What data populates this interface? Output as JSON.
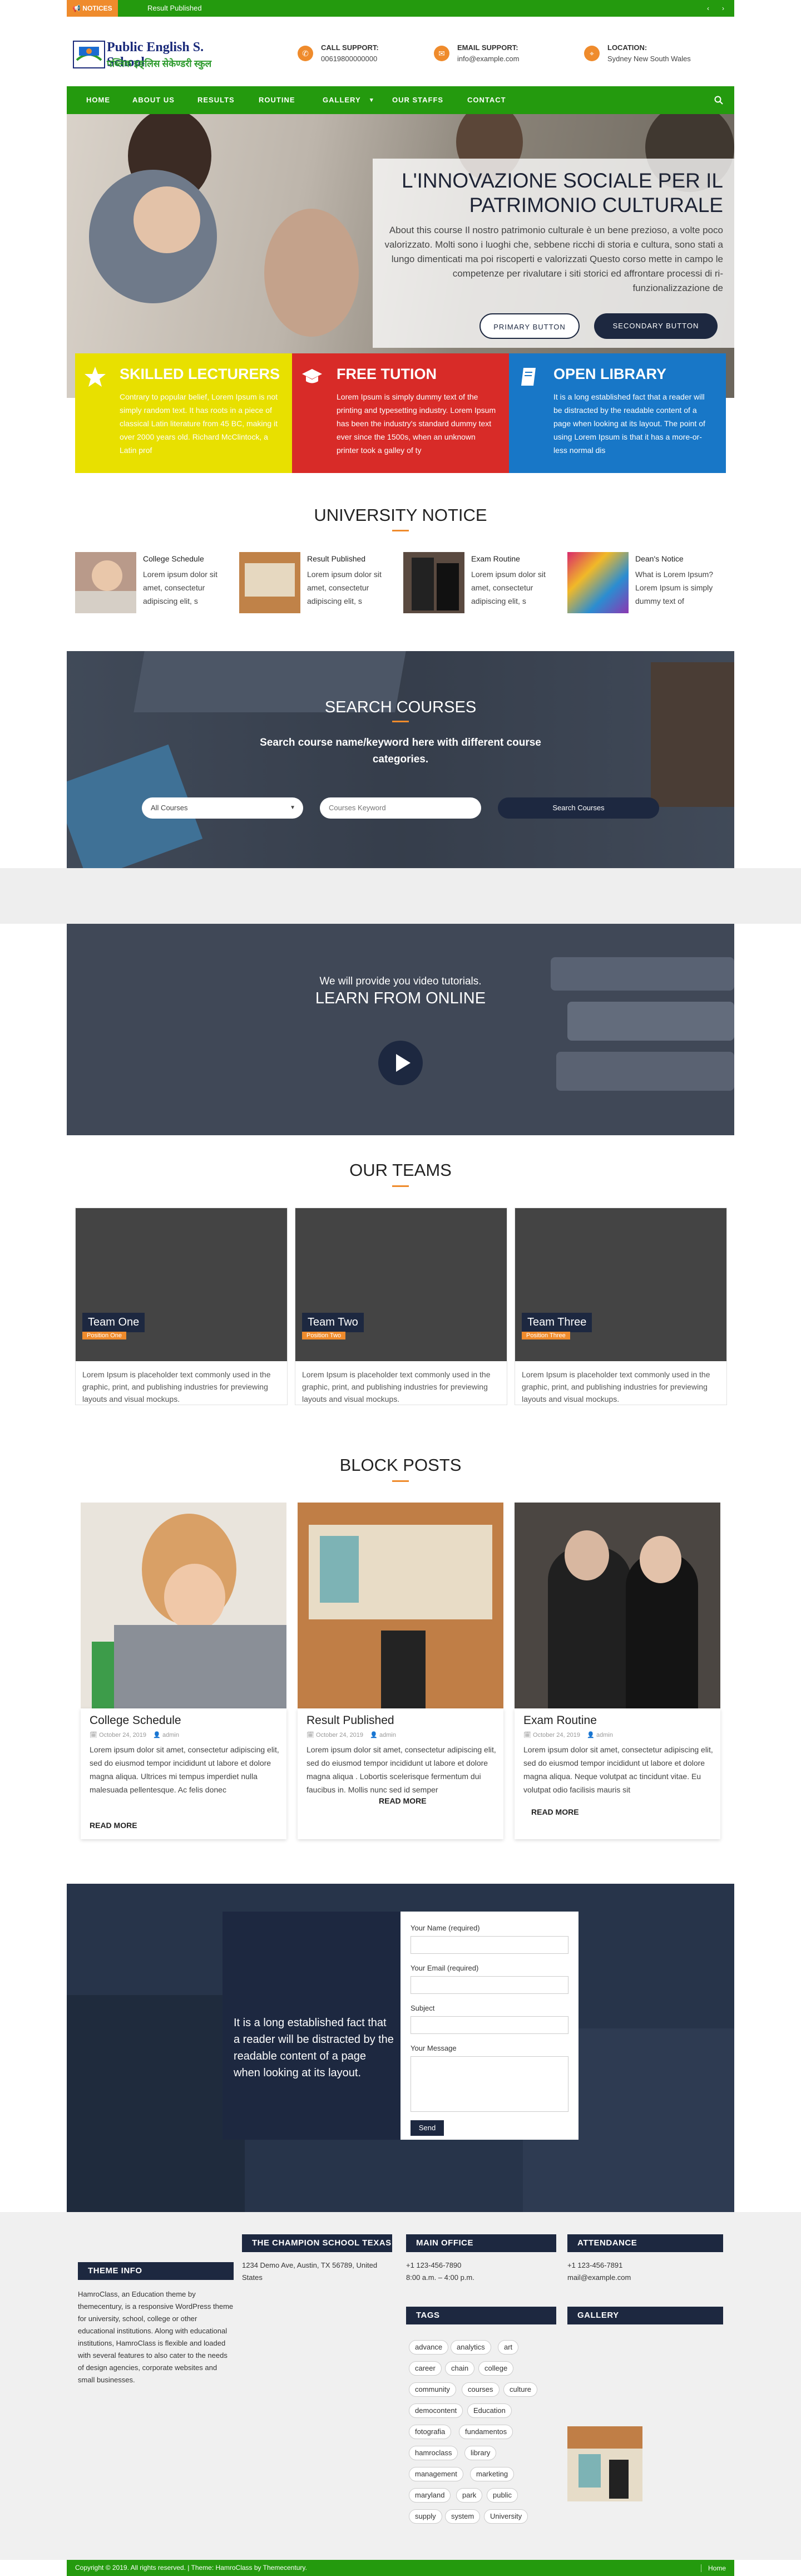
{
  "topbar": {
    "notice_label": "NOTICES",
    "notice_text": "Result Published",
    "prev": "‹",
    "next": "›"
  },
  "header": {
    "logo_title": "Public English S. School",
    "logo_subtitle": "पब्लिक इङ्लिस सेकेण्डरी स्कुल",
    "call": {
      "label": "CALL SUPPORT:",
      "value": "00619800000000"
    },
    "email": {
      "label": "EMAIL SUPPORT:",
      "value": "info@example.com"
    },
    "location": {
      "label": "LOCATION:",
      "value": "Sydney New South Wales"
    }
  },
  "nav": {
    "items": [
      "HOME",
      "ABOUT US",
      "RESULTS",
      "ROUTINE",
      "GALLERY",
      "OUR STAFFS",
      "CONTACT"
    ],
    "gallery_caret": "▾"
  },
  "hero": {
    "title": "L'INNOVAZIONE SOCIALE PER IL PATRIMONIO CULTURALE",
    "text": "About this course Il nostro patrimonio culturale è un bene prezioso, a volte poco valorizzato. Molti sono i luoghi che, sebbene ricchi di storia e cultura, sono stati a lungo dimenticati ma poi riscoperti e valorizzati Questo corso mette in campo le competenze per rivalutare i siti storici ed affrontare processi di ri-funzionalizzazione de",
    "primary": "PRIMARY BUTTON",
    "secondary": "SECONDARY BUTTON"
  },
  "features": [
    {
      "title": "SKILLED LECTURERS",
      "text": "Contrary to popular belief, Lorem Ipsum is not simply random text. It has roots in a piece of classical Latin literature from 45 BC, making it over 2000 years old. Richard McClintock, a Latin prof",
      "color": "#e8e000"
    },
    {
      "title": "FREE TUTION",
      "text": "Lorem Ipsum is simply dummy text of the printing and typesetting industry. Lorem Ipsum has been the industry's standard dummy text ever since the 1500s, when an unknown printer took a galley of ty",
      "color": "#d82b28"
    },
    {
      "title": "OPEN LIBRARY",
      "text": "It is a long established fact that a reader will be distracted by the readable content of a page when looking at its layout. The point of using Lorem Ipsum is that it has a more-or-less normal dis",
      "color": "#1877c7"
    }
  ],
  "notice": {
    "title": "UNIVERSITY NOTICE",
    "items": [
      {
        "title": "College Schedule",
        "text": "Lorem ipsum dolor sit amet, consectetur adipiscing elit, s"
      },
      {
        "title": "Result Published",
        "text": "Lorem ipsum dolor sit amet, consectetur adipiscing elit, s"
      },
      {
        "title": "Exam Routine",
        "text": "Lorem ipsum dolor sit amet, consectetur adipiscing elit, s"
      },
      {
        "title": "Dean's Notice",
        "text": "What is Lorem Ipsum? Lorem Ipsum is simply dummy text of"
      }
    ]
  },
  "search": {
    "title": "SEARCH COURSES",
    "subtitle": "Search course name/keyword here with different course categories.",
    "select": "All Courses",
    "placeholder": "Courses Keyword",
    "button": "Search Courses"
  },
  "video": {
    "subtitle": "We will provide you video tutorials.",
    "title": "LEARN FROM ONLINE"
  },
  "teams": {
    "title": "OUR TEAMS",
    "items": [
      {
        "name": "Team One",
        "position": "Position One",
        "text": "Lorem Ipsum is placeholder text commonly used in the graphic, print, and publishing industries for previewing layouts and visual mockups."
      },
      {
        "name": "Team Two",
        "position": "Position Two",
        "text": "Lorem Ipsum is placeholder text commonly used in the graphic, print, and publishing industries for previewing layouts and visual mockups."
      },
      {
        "name": "Team Three",
        "position": "Position Three",
        "text": "Lorem Ipsum is placeholder text commonly used in the graphic, print, and publishing industries for previewing layouts and visual mockups."
      }
    ]
  },
  "posts": {
    "title": "BLOCK POSTS",
    "more": "READ MORE",
    "items": [
      {
        "title": "College Schedule",
        "date": "October 24, 2019",
        "author": "admin",
        "text": "Lorem ipsum dolor sit amet, consectetur adipiscing elit, sed do eiusmod tempor incididunt ut labore et dolore magna aliqua. Ultrices mi tempus imperdiet nulla malesuada pellentesque. Ac felis donec"
      },
      {
        "title": "Result Published",
        "date": "October 24, 2019",
        "author": "admin",
        "text": "Lorem ipsum dolor sit amet, consectetur adipiscing elit, sed do eiusmod tempor incididunt ut labore et dolore magna aliqua . Lobortis scelerisque fermentum dui faucibus in. Mollis nunc sed id semper"
      },
      {
        "title": "Exam Routine",
        "date": "October 24, 2019",
        "author": "admin",
        "text": "Lorem ipsum dolor sit amet, consectetur adipiscing elit, sed do eiusmod tempor incididunt ut labore et dolore magna aliqua. Neque volutpat ac tincidunt vitae. Eu volutpat odio facilisis mauris sit"
      }
    ]
  },
  "contact": {
    "quote": "It is a long established fact that a reader will be distracted by the readable content of a page when looking at its layout.",
    "name_label": "Your Name (required)",
    "email_label": "Your Email (required)",
    "subject_label": "Subject",
    "message_label": "Your Message",
    "send": "Send"
  },
  "footer": {
    "theme_info": {
      "title": "THEME INFO",
      "text": "HamroClass, an Education theme by themecentury, is a responsive WordPress theme for university, school, college or other educational institutions. Along with educational institutions, HamroClass is flexible and loaded with several features to also cater to the needs of design agencies, corporate websites and small businesses."
    },
    "school": {
      "title": "THE CHAMPION SCHOOL TEXAS",
      "text": "1234 Demo Ave, Austin, TX 56789, United States"
    },
    "main_office": {
      "title": "MAIN OFFICE",
      "phone": "+1 123-456-7890",
      "hours": "8:00 a.m. – 4:00 p.m."
    },
    "attendance": {
      "title": "ATTENDANCE",
      "phone": "+1 123-456-7891",
      "email": "mail@example.com"
    },
    "tags": {
      "title": "TAGS",
      "items": [
        "advance",
        "analytics",
        "art",
        "career",
        "chain",
        "college",
        "community",
        "courses",
        "culture",
        "democontent",
        "Education",
        "fotografia",
        "fundamentos",
        "hamroclass",
        "library",
        "management",
        "marketing",
        "maryland",
        "park",
        "public",
        "supply",
        "system",
        "University"
      ]
    },
    "gallery": {
      "title": "GALLERY"
    }
  },
  "copyright": {
    "text": "Copyright © 2019. All rights reserved. | Theme: HamroClass by Themecentury.",
    "home": "Home"
  }
}
